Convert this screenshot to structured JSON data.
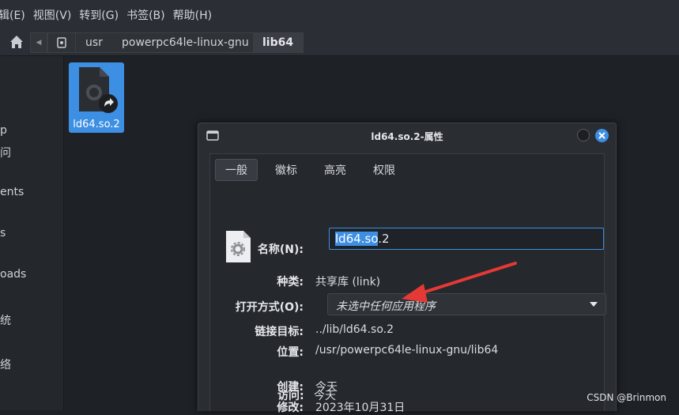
{
  "menubar": {
    "items": [
      "编辑(E)",
      "视图(V)",
      "转到(G)",
      "书签(B)",
      "帮助(H)"
    ],
    "first_visible": "辑(E)"
  },
  "pathbar": {
    "crumbs": [
      "usr",
      "powerpc64le-linux-gnu",
      "lib64"
    ]
  },
  "sidebar": {
    "fragments": [
      "p",
      "问",
      "ents",
      "s",
      "oads",
      "统",
      "络"
    ]
  },
  "content": {
    "file_name": "ld64.so.2"
  },
  "dialog": {
    "title": "ld64.so.2-属性",
    "tabs": [
      "一般",
      "徽标",
      "高亮",
      "权限"
    ],
    "name_label": "名称(N):",
    "name_value_selected": "ld64.so",
    "name_value_rest": ".2",
    "type_label": "种类:",
    "type_value": "共享库 (link)",
    "open_with_label": "打开方式(O):",
    "open_with_value": "未选中任何应用程序",
    "link_target_label": "链接目标:",
    "link_target_value": "../lib/ld64.so.2",
    "location_label": "位置:",
    "location_value": "/usr/powerpc64le-linux-gnu/lib64",
    "created_label": "创建:",
    "created_value": "今天",
    "modified_label": "修改:",
    "modified_value": "2023年10月31日",
    "accessed_label": "访问:",
    "accessed_value": "今天"
  },
  "watermark": "CSDN @Brinmon",
  "colors": {
    "accent": "#3d8fe3",
    "arrow": "#e53935",
    "close_button": "#3d8fe3"
  }
}
